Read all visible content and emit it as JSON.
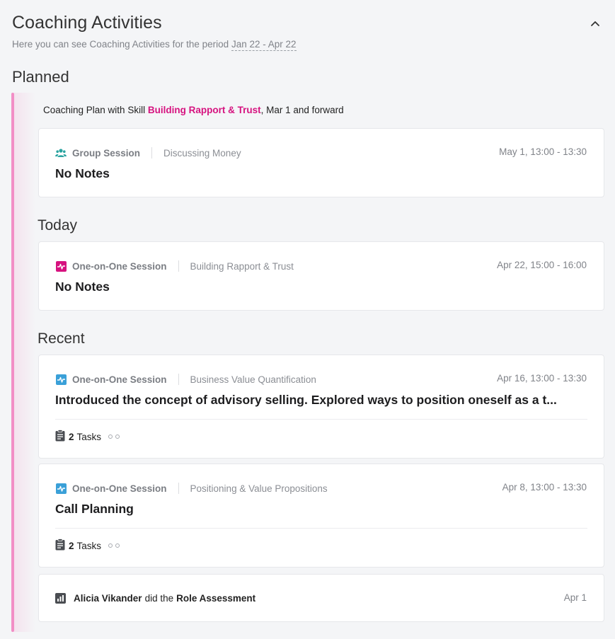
{
  "header": {
    "title": "Coaching Activities",
    "subtitle_prefix": "Here you can see Coaching Activities for the period",
    "period": "Jan 22 - Apr 22"
  },
  "planned": {
    "heading": "Planned",
    "plan_prefix": "Coaching Plan with Skill",
    "plan_skill": "Building Rapport & Trust",
    "plan_suffix": ", Mar 1 and forward",
    "cards": [
      {
        "type": "Group Session",
        "icon": "group-icon",
        "skill": "Discussing Money",
        "date": "May 1, 13:00 - 13:30",
        "notes": "No Notes"
      }
    ]
  },
  "today": {
    "heading": "Today",
    "cards": [
      {
        "type": "One-on-One Session",
        "icon": "pulse-icon",
        "icon_color": "#d6127f",
        "skill": "Building Rapport & Trust",
        "date": "Apr 22, 15:00 - 16:00",
        "notes": "No Notes"
      }
    ]
  },
  "recent": {
    "heading": "Recent",
    "cards": [
      {
        "type": "One-on-One Session",
        "icon": "pulse-icon",
        "icon_color": "#3aa0d8",
        "skill": "Business Value Quantification",
        "date": "Apr 16, 13:00 - 13:30",
        "notes": "Introduced the concept of advisory selling. Explored ways to position oneself as a t...",
        "tasks_count": "2",
        "tasks_label": "Tasks"
      },
      {
        "type": "One-on-One Session",
        "icon": "pulse-icon",
        "icon_color": "#3aa0d8",
        "skill": "Positioning & Value Propositions",
        "date": "Apr 8, 13:00 - 13:30",
        "notes": "Call Planning",
        "tasks_count": "2",
        "tasks_label": "Tasks"
      }
    ],
    "assessment": {
      "person": "Alicia Vikander",
      "verb": "did the",
      "item": "Role Assessment",
      "date": "Apr 1",
      "icon": "bar-chart-icon"
    }
  },
  "colors": {
    "accent": "#d6127f",
    "timeline": "#f28ec6",
    "group_icon": "#2aa3a0",
    "one_on_one_blue": "#3aa0d8"
  }
}
